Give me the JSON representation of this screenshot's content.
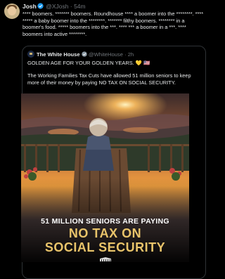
{
  "post": {
    "author_name": "Josh",
    "author_handle": "@XJosh",
    "separator": "·",
    "time": "54m",
    "body": "**** boomers. ******* boomers. Roundhouse **** a boomer into the ********. **** ***** a baby boomer into the ********. ******* filthy boomers. ******** in a boomer's food. ***** boomers into the ***. **** *** a boomer in a ***. **** boomers into active ********."
  },
  "quote": {
    "author_name": "The White House",
    "author_handle": "@WhiteHouse",
    "separator": "·",
    "time": "2h",
    "line1": "GOLDEN AGE FOR YOUR GOLDEN YEARS. 💛 🇺🇸",
    "line2": "The Working Families Tax Cuts have allowed 51 million seniors to keep more of their money by paying NO TAX ON SOCIAL SECURITY.",
    "image_caption_1": "51 MILLION SENIORS ARE PAYING",
    "image_caption_2": "NO TAX ON",
    "image_caption_3": "SOCIAL SECURITY"
  },
  "colors": {
    "background": "#000000",
    "text": "#e7e9ea",
    "muted": "#71767b",
    "verified": "#1d9bf0",
    "gold_verified": "#8d9ba6",
    "caption_gold": "#e9c46a"
  },
  "icons": [
    "verified-badge-icon",
    "government-badge-icon",
    "white-house-logo-icon"
  ]
}
